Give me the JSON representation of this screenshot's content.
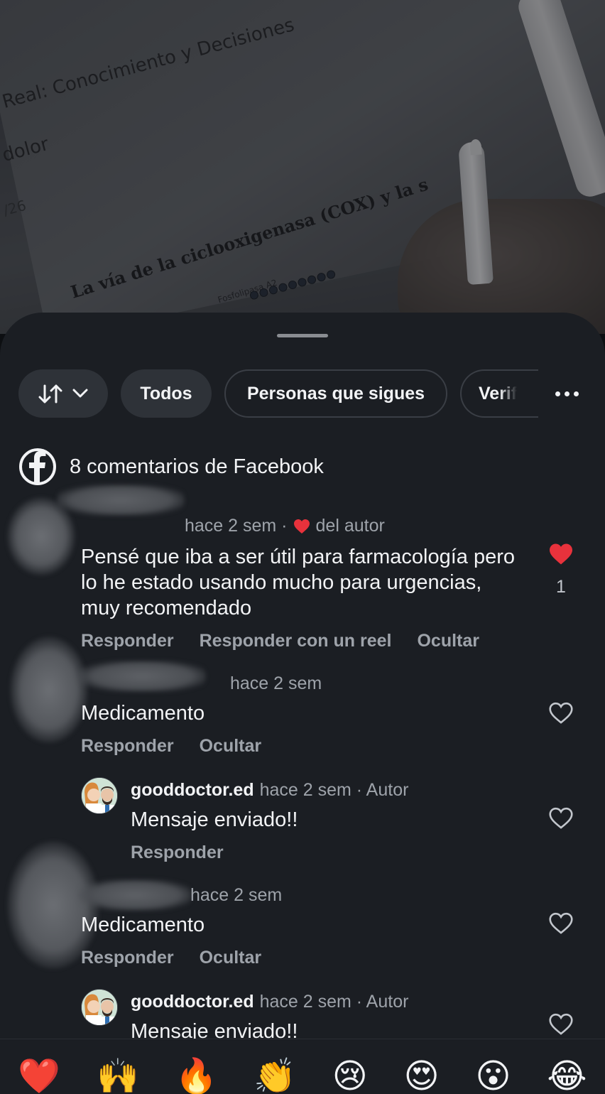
{
  "video": {
    "line1": "Real: Conocimiento y Decisiones",
    "line2": "dolor",
    "line3": "/26",
    "heading": "La vía de la ciclooxigenasa (COX) y la s",
    "small_label": "Fosfolipasa A2"
  },
  "filters": {
    "todos": "Todos",
    "following": "Personas que sigues",
    "verified": "Verif"
  },
  "comments_header": {
    "title": "8 comentarios de Facebook"
  },
  "comments": [
    {
      "meta": "hace 2 sem ·",
      "author_like": "del autor",
      "text": "Pensé que iba a ser útil para farmacología pero lo he estado usando mucho para urgencias, muy recomendado",
      "actions": [
        "Responder",
        "Responder con un reel",
        "Ocultar"
      ],
      "like_count": "1"
    },
    {
      "meta": "hace 2 sem",
      "text": "Medicamento",
      "actions": [
        "Responder",
        "Ocultar"
      ]
    },
    {
      "user": "gooddoctor.ed",
      "meta": "hace 2 sem · Autor",
      "text": "Mensaje enviado!!",
      "actions": [
        "Responder"
      ]
    },
    {
      "meta": "hace 2 sem",
      "text": "Medicamento",
      "actions": [
        "Responder",
        "Ocultar"
      ]
    },
    {
      "user": "gooddoctor.ed",
      "meta": "hace 2 sem · Autor",
      "text": "Mensaje enviado!!"
    }
  ],
  "emojis": [
    "❤️",
    "🙌",
    "🔥",
    "👏",
    "😢",
    "😍",
    "😮",
    "😂"
  ],
  "colors": {
    "sheet_bg": "#1b1e23",
    "chip_bg": "#2e3238",
    "like_red": "#e8323c",
    "muted_text": "#9ea3aa"
  }
}
